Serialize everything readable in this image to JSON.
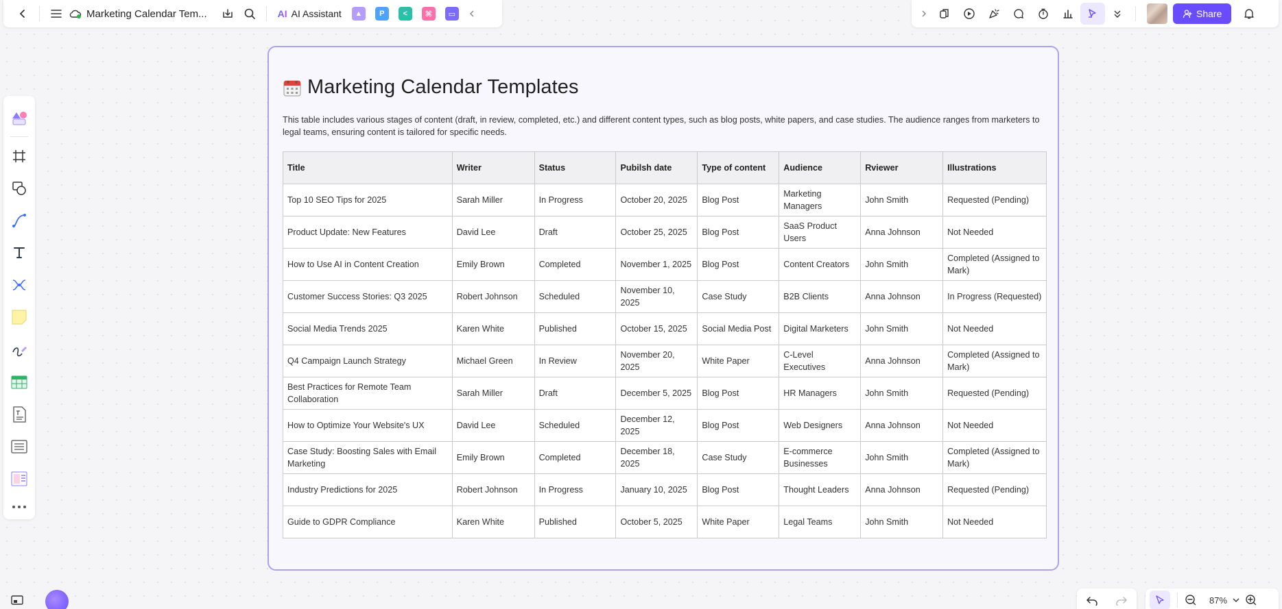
{
  "topbar": {
    "doc_title": "Marketing Calendar Tem...",
    "ai_label": "AI Assistant"
  },
  "share": {
    "label": "Share"
  },
  "zoom": {
    "value": "87%"
  },
  "frame": {
    "title": "Marketing Calendar Templates",
    "description": "This table includes various stages of content (draft, in review, completed, etc.) and different content types, such as blog posts, white papers, and case studies. The audience ranges from marketers to legal teams, ensuring content is tailored for specific needs."
  },
  "table": {
    "headers": [
      "Title",
      "Writer",
      "Status",
      "Pubilsh date",
      "Type of content",
      "Audience",
      "Rviewer",
      "Illustrations"
    ],
    "rows": [
      [
        "Top 10 SEO Tips for 2025",
        "Sarah Miller",
        "In Progress",
        "October 20, 2025",
        "Blog Post",
        "Marketing Managers",
        "John Smith",
        "Requested (Pending)"
      ],
      [
        "Product Update: New Features",
        "David Lee",
        "Draft",
        "October 25, 2025",
        "Blog Post",
        "SaaS Product Users",
        "Anna Johnson",
        "Not Needed"
      ],
      [
        "How to Use AI in Content Creation",
        "Emily Brown",
        "Completed",
        "November 1, 2025",
        "Blog Post",
        "Content Creators",
        "John Smith",
        "Completed (Assigned to Mark)"
      ],
      [
        "Customer Success Stories: Q3 2025",
        "Robert Johnson",
        "Scheduled",
        "November 10, 2025",
        "Case Study",
        "B2B Clients",
        "Anna Johnson",
        "In Progress (Requested)"
      ],
      [
        "Social Media Trends 2025",
        "Karen White",
        "Published",
        "October 15, 2025",
        "Social Media Post",
        "Digital Marketers",
        "John Smith",
        "Not Needed"
      ],
      [
        "Q4 Campaign Launch Strategy",
        "Michael Green",
        "In Review",
        "November 20, 2025",
        "White Paper",
        "C-Level Executives",
        "Anna Johnson",
        "Completed (Assigned to Mark)"
      ],
      [
        "Best Practices for Remote Team Collaboration",
        "Sarah Miller",
        "Draft",
        "December 5, 2025",
        "Blog Post",
        "HR Managers",
        "John Smith",
        "Requested (Pending)"
      ],
      [
        "How to Optimize Your Website's UX",
        "David Lee",
        "Scheduled",
        "December 12, 2025",
        "Blog Post",
        "Web Designers",
        "Anna Johnson",
        "Not Needed"
      ],
      [
        "Case Study: Boosting Sales with Email Marketing",
        "Emily Brown",
        "Completed",
        "December 18, 2025",
        "Case Study",
        "E-commerce Businesses",
        "John Smith",
        "Completed (Assigned to Mark)"
      ],
      [
        "Industry Predictions for 2025",
        "Robert Johnson",
        "In Progress",
        "January 10, 2025",
        "Blog Post",
        "Thought Leaders",
        "Anna Johnson",
        "Requested (Pending)"
      ],
      [
        "Guide to GDPR Compliance",
        "Karen White",
        "Published",
        "October 5, 2025",
        "White Paper",
        "Legal Teams",
        "John Smith",
        "Not Needed"
      ]
    ]
  },
  "colors": {
    "accent": "#6a4cff",
    "frame_border": "#aaa2ef",
    "frame_bg": "#f8f7fd"
  }
}
